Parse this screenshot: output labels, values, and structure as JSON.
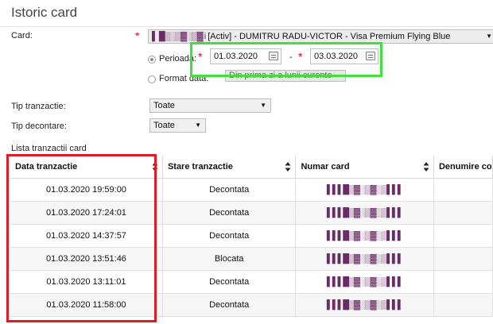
{
  "page": {
    "title": "Istoric card"
  },
  "card": {
    "label": "Card:",
    "required_mark": "*",
    "masked_prefix": "▌ █▒░▒▓░▒▓ i",
    "value": "[Activ] - DUMITRU RADU-VICTOR - Visa Premium Flying Blue"
  },
  "period": {
    "radio_label": "Perioada:",
    "required_mark": "*",
    "from": "01.03.2020",
    "separator": "-",
    "to": "03.03.2020"
  },
  "format": {
    "radio_label": "Format data:",
    "select_value": "Din prima zi a lunii curente"
  },
  "filters": {
    "transaction_type_label": "Tip tranzactie:",
    "transaction_type_value": "Toate",
    "settlement_type_label": "Tip decontare:",
    "settlement_type_value": "Toate"
  },
  "list": {
    "title": "Lista tranzactii card"
  },
  "table": {
    "columns": [
      "Data tranzactie",
      "Stare tranzactie",
      "Numar card",
      "Denumire co"
    ],
    "masked_card": "▌▌▌█▒▓░▒▓░▒▌▌▌",
    "rows": [
      {
        "date": "01.03.2020 19:59:00",
        "status": "Decontata"
      },
      {
        "date": "01.03.2020 17:24:01",
        "status": "Decontata"
      },
      {
        "date": "01.03.2020 14:37:57",
        "status": "Decontata"
      },
      {
        "date": "01.03.2020 13:51:46",
        "status": "Blocata"
      },
      {
        "date": "01.03.2020 13:11:01",
        "status": "Decontata"
      },
      {
        "date": "01.03.2020 11:58:00",
        "status": "Decontata"
      }
    ]
  },
  "colors": {
    "highlight_green": "#3ee03a",
    "highlight_red": "#e01b24",
    "required": "#d0102a"
  }
}
